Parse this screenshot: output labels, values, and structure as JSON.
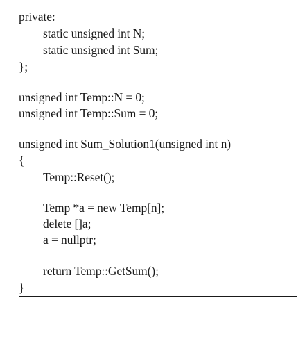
{
  "code": {
    "lines": [
      "private:",
      "static unsigned int N;",
      "static unsigned int Sum;",
      "};",
      "unsigned int Temp::N = 0;",
      "unsigned int Temp::Sum = 0;",
      "unsigned int Sum_Solution1(unsigned int n)",
      "{",
      "Temp::Reset();",
      "Temp *a = new Temp[n];",
      "delete []a;",
      "a = nullptr;",
      "return Temp::GetSum();",
      "}"
    ]
  }
}
